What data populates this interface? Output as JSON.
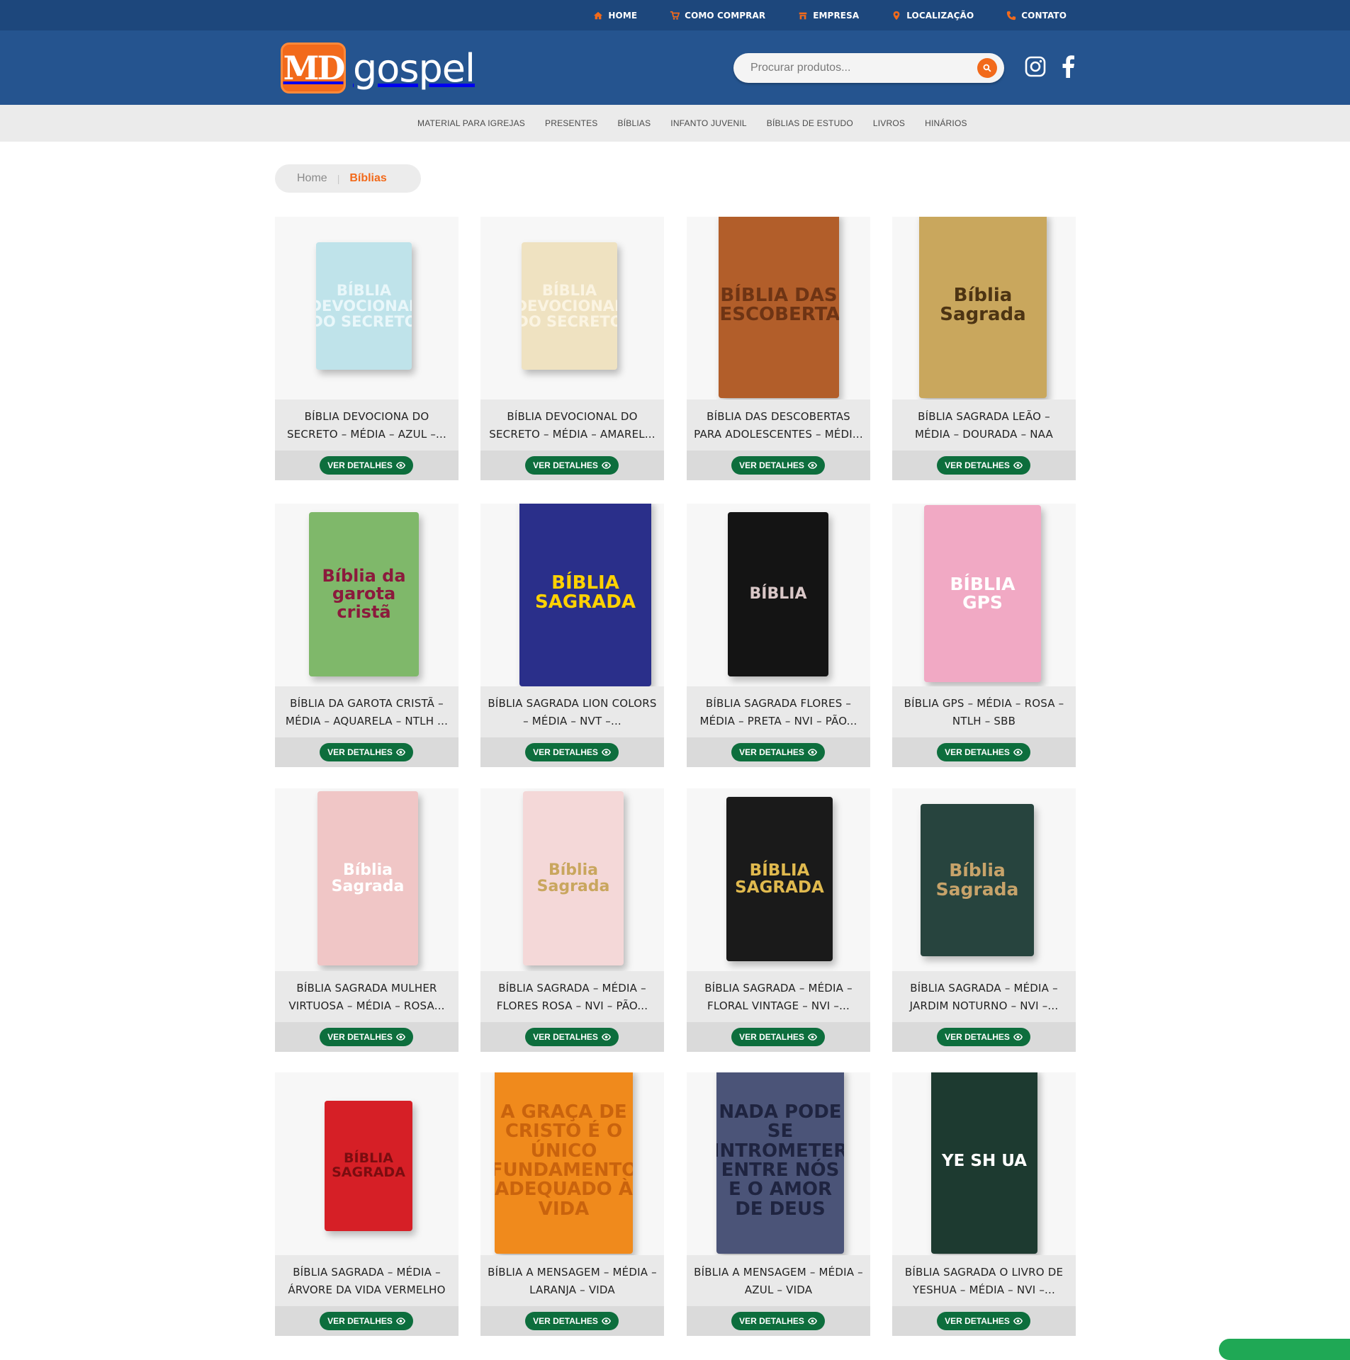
{
  "topnav": [
    {
      "label": "HOME",
      "icon": "home-icon"
    },
    {
      "label": "COMO COMPRAR",
      "icon": "cart-icon"
    },
    {
      "label": "EMPRESA",
      "icon": "store-icon"
    },
    {
      "label": "LOCALIZAÇÃO",
      "icon": "map-pin-icon"
    },
    {
      "label": "CONTATO",
      "icon": "phone-icon"
    }
  ],
  "brand": {
    "md": "MD",
    "name": "gospel",
    "accent": "#f26a1b",
    "primary": "#25548f",
    "dark": "#1d477c"
  },
  "search": {
    "placeholder": "Procurar produtos..."
  },
  "categories": [
    "MATERIAL PARA IGREJAS",
    "PRESENTES",
    "BÍBLIAS",
    "INFANTO JUVENIL",
    "BÍBLIAS DE ESTUDO",
    "LIVROS",
    "HINÁRIOS"
  ],
  "breadcrumb": {
    "home": "Home",
    "separator": "|",
    "current": "Bíblias"
  },
  "button_label": "VER DETALHES",
  "products": [
    {
      "title": "BÍBLIA DEVOCIONA DO SECRETO – MÉDIA – AZUL –...",
      "cover": "#bfe3ea",
      "cover_text": "BÍBLIA DEVOCIONAL DO SECRETO",
      "text_color": "#e9f7fa"
    },
    {
      "title": "BÍBLIA DEVOCIONAL DO SECRETO – MÉDIA – AMAREL...",
      "cover": "#efe2c1",
      "cover_text": "BÍBLIA DEVOCIONAL DO SECRETO",
      "text_color": "#fbf4e2"
    },
    {
      "title": "BÍBLIA DAS DESCOBERTAS PARA ADOLESCENTES – MÉDI...",
      "cover": "#b25e2a",
      "cover_text": "BÍBLIA DAS DESCOBERTAS",
      "text_color": "#6e3414"
    },
    {
      "title": "BÍBLIA SAGRADA LEÃO – MÉDIA – DOURADA – NAA",
      "cover": "#c9a75d",
      "cover_text": "Bíblia Sagrada",
      "text_color": "#4d3413"
    },
    {
      "title": "BÍBLIA DA GAROTA CRISTÃ – MÉDIA – AQUARELA – NTLH ...",
      "cover": "#7fb86a",
      "cover_text": "Bíblia da garota cristã",
      "text_color": "#8b1a3c"
    },
    {
      "title": "BÍBLIA SAGRADA LION COLORS – MÉDIA – NVT –...",
      "cover": "#2a2f8a",
      "cover_text": "BÍBLIA SAGRADA",
      "text_color": "#ffd200"
    },
    {
      "title": "BÍBLIA SAGRADA FLORES – MÉDIA – PRETA – NVI – PÃO...",
      "cover": "#141414",
      "cover_text": "BÍBLIA",
      "text_color": "#d9c7c7"
    },
    {
      "title": "BÍBLIA GPS – MÉDIA – ROSA – NTLH – SBB",
      "cover": "#f1a9c4",
      "cover_text": "BÍBLIA GPS",
      "text_color": "#ffffff"
    },
    {
      "title": "BÍBLIA SAGRADA MULHER VIRTUOSA – MÉDIA – ROSA...",
      "cover": "#f0c6c6",
      "cover_text": "Bíblia Sagrada",
      "text_color": "#ffffff"
    },
    {
      "title": "BÍBLIA SAGRADA – MÉDIA – FLORES ROSA – NVI – PÃO...",
      "cover": "#f4d8d8",
      "cover_text": "Bíblia Sagrada",
      "text_color": "#c9a65e"
    },
    {
      "title": "BÍBLIA SAGRADA – MÉDIA – FLORAL VINTAGE – NVI –...",
      "cover": "#1a1a1a",
      "cover_text": "BÍBLIA SAGRADA",
      "text_color": "#e0b94e"
    },
    {
      "title": "BÍBLIA SAGRADA – MÉDIA – JARDIM NOTURNO – NVI –...",
      "cover": "#27443e",
      "cover_text": "Bíblia Sagrada",
      "text_color": "#c7a36a"
    },
    {
      "title": "BÍBLIA SAGRADA – MÉDIA – ÁRVORE DA VIDA VERMELHO ...",
      "cover": "#d61f26",
      "cover_text": "BÍBLIA SAGRADA",
      "text_color": "#7a0d10"
    },
    {
      "title": "BÍBLIA A MENSAGEM – MÉDIA – LARANJA – VIDA",
      "cover": "#f08a1c",
      "cover_text": "A GRAÇA DE CRISTO É O ÚNICO FUNDAMENTO ADEQUADO À VIDA",
      "text_color": "#c9630d"
    },
    {
      "title": "BÍBLIA A MENSAGEM – MÉDIA – AZUL – VIDA",
      "cover": "#4b5478",
      "cover_text": "NADA PODE SE INTROMETER ENTRE NÓS E O AMOR DE DEUS",
      "text_color": "#1f2440"
    },
    {
      "title": "BÍBLIA SAGRADA O LIVRO DE YESHUA – MÉDIA – NVI –...",
      "cover": "#1d3a30",
      "cover_text": "YE SH UA",
      "text_color": "#ffffff"
    }
  ]
}
